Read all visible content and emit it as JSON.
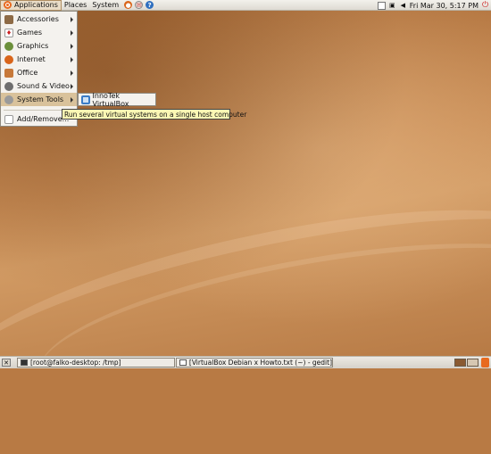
{
  "top_panel": {
    "menus": [
      "Applications",
      "Places",
      "System"
    ],
    "clock": "Fri Mar 30,  5:17 PM"
  },
  "app_menu": {
    "items": [
      {
        "label": "Accessories",
        "icon": "accessories-icon"
      },
      {
        "label": "Games",
        "icon": "games-icon"
      },
      {
        "label": "Graphics",
        "icon": "graphics-icon"
      },
      {
        "label": "Internet",
        "icon": "internet-icon"
      },
      {
        "label": "Office",
        "icon": "office-icon"
      },
      {
        "label": "Sound & Video",
        "icon": "sound-video-icon"
      },
      {
        "label": "System Tools",
        "icon": "system-tools-icon"
      }
    ],
    "add_remove": "Add/Remove...",
    "active_color": "#d9c29b"
  },
  "submenu": {
    "items": [
      {
        "label": "InnoTek VirtualBox",
        "icon": "virtualbox-icon"
      }
    ]
  },
  "tooltip": "Run several virtual systems on a single host computer",
  "bottom_panel": {
    "tasks": [
      "[root@falko-desktop: /tmp]",
      "[VirtualBox Debian x Howto.txt (~) - gedit]"
    ]
  }
}
